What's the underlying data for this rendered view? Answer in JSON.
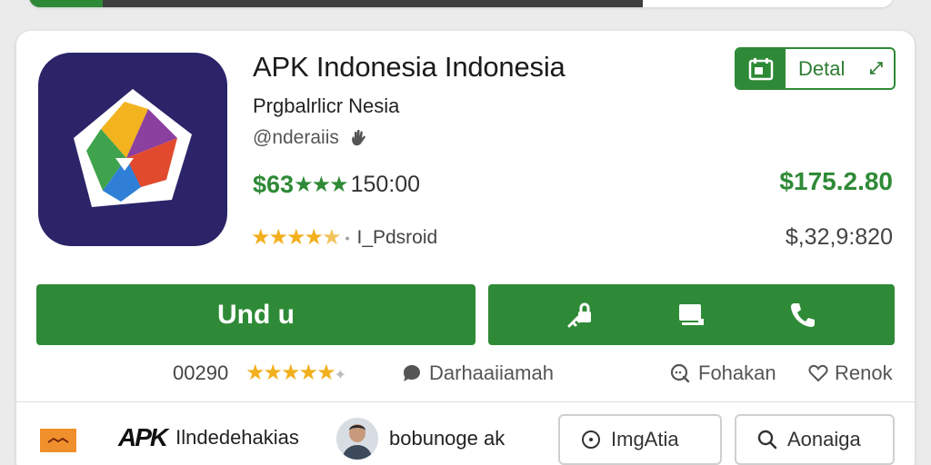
{
  "top_bar": {
    "progress": 0.71
  },
  "app": {
    "title": "APK Indonesia Indonesia",
    "subtitle": "Prgbalrlicr Nesia",
    "handle": "@nderaiis",
    "price": "$63",
    "rating_count": "150:00",
    "platform": "I_Pdsroid",
    "right_price": "$175.2.80",
    "right_sub": "$,32,9:820"
  },
  "detail_button": {
    "label": "Detal"
  },
  "actions": {
    "download_label": "Und u",
    "icons": [
      "lock-icon",
      "monitor-icon",
      "phone-icon"
    ]
  },
  "meta": {
    "count": "00290",
    "discussion_label": "Darhaaiiamah",
    "share_label": "Fohakan",
    "report_label": "Renok"
  },
  "bottom": {
    "brand_logo": "APK",
    "brand_name": "Ilndedehakias",
    "author": "bobunoge ak",
    "pill1_label": "ImgAtia",
    "pill2_label": "Aonaiga"
  },
  "colors": {
    "accent": "#2e8a36",
    "star": "#f2b01e",
    "icon_bg": "#2b2468",
    "flag": "#f0902c"
  }
}
